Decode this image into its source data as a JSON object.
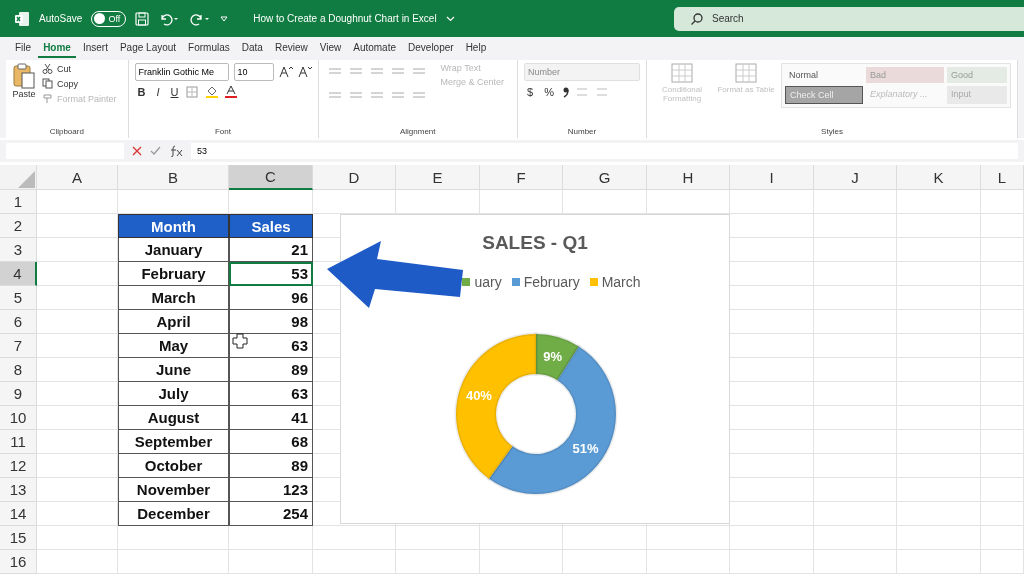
{
  "title_bar": {
    "autosave_label": "AutoSave",
    "autosave": {
      "label": "Off",
      "on": false
    },
    "document_title": "How to Create a Doughnut Chart in Excel",
    "search": {
      "placeholder": "Search"
    }
  },
  "menu_tabs": [
    {
      "label": "File",
      "selected": false
    },
    {
      "label": "Home",
      "selected": true
    },
    {
      "label": "Insert",
      "selected": false
    },
    {
      "label": "Page Layout",
      "selected": false
    },
    {
      "label": "Formulas",
      "selected": false
    },
    {
      "label": "Data",
      "selected": false
    },
    {
      "label": "Review",
      "selected": false
    },
    {
      "label": "View",
      "selected": false
    },
    {
      "label": "Automate",
      "selected": false
    },
    {
      "label": "Developer",
      "selected": false
    },
    {
      "label": "Help",
      "selected": false
    }
  ],
  "ribbon": {
    "clipboard": {
      "label": "Clipboard",
      "paste": "Paste",
      "cut": "Cut",
      "copy": "Copy",
      "format_painter": {
        "label": "Format Painter",
        "disabled": true
      }
    },
    "font": {
      "label": "Font",
      "font_name": "Franklin Gothic Me",
      "font_size": "10",
      "bold": "B",
      "italic": "I",
      "underline": "U"
    },
    "alignment": {
      "label": "Alignment",
      "wrap_text": {
        "label": "Wrap Text",
        "disabled": true
      },
      "merge_center": {
        "label": "Merge & Center",
        "disabled": true
      }
    },
    "number": {
      "label": "Number",
      "format": {
        "value": "Number",
        "disabled": true
      },
      "currency": "$",
      "percent": "%"
    },
    "styles": {
      "label": "Styles",
      "conditional_formatting": {
        "label": "Conditional Formatting",
        "disabled": true
      },
      "format_as_table": {
        "label": "Format as Table",
        "disabled": true
      },
      "cell_styles": [
        {
          "label": "Normal",
          "kind": "normal"
        },
        {
          "label": "Bad",
          "kind": "bad"
        },
        {
          "label": "Good",
          "kind": "good"
        },
        {
          "label": "Check Cell",
          "kind": "check"
        },
        {
          "label": "Explanatory ...",
          "kind": "explanatory"
        },
        {
          "label": "Input",
          "kind": "input"
        }
      ]
    }
  },
  "formula_bar": {
    "value": "53"
  },
  "sheet": {
    "columns": [
      {
        "label": "A",
        "selected": false
      },
      {
        "label": "B",
        "selected": false
      },
      {
        "label": "C",
        "selected": true
      },
      {
        "label": "D",
        "selected": false
      },
      {
        "label": "E",
        "selected": false
      },
      {
        "label": "F",
        "selected": false
      },
      {
        "label": "G",
        "selected": false
      },
      {
        "label": "H",
        "selected": false
      },
      {
        "label": "I",
        "selected": false
      },
      {
        "label": "J",
        "selected": false
      },
      {
        "label": "K",
        "selected": false
      },
      {
        "label": "L",
        "selected": false
      }
    ],
    "rows": [
      {
        "label": "1",
        "selected": false
      },
      {
        "label": "2",
        "selected": false
      },
      {
        "label": "3",
        "selected": false
      },
      {
        "label": "4",
        "selected": true
      },
      {
        "label": "5",
        "selected": false
      },
      {
        "label": "6",
        "selected": false
      },
      {
        "label": "7",
        "selected": false
      },
      {
        "label": "8",
        "selected": false
      },
      {
        "label": "9",
        "selected": false
      },
      {
        "label": "10",
        "selected": false
      },
      {
        "label": "11",
        "selected": false
      },
      {
        "label": "12",
        "selected": false
      },
      {
        "label": "13",
        "selected": false
      },
      {
        "label": "14",
        "selected": false
      },
      {
        "label": "15",
        "selected": false
      },
      {
        "label": "16",
        "selected": false
      }
    ],
    "table": {
      "header": [
        "Month",
        "Sales"
      ],
      "rows": [
        {
          "month": "January",
          "sales": "21",
          "selected": false
        },
        {
          "month": "February",
          "sales": "53",
          "selected": true
        },
        {
          "month": "March",
          "sales": "96",
          "selected": false
        },
        {
          "month": "April",
          "sales": "98",
          "selected": false
        },
        {
          "month": "May",
          "sales": "63",
          "selected": false
        },
        {
          "month": "June",
          "sales": "89",
          "selected": false
        },
        {
          "month": "July",
          "sales": "63",
          "selected": false
        },
        {
          "month": "August",
          "sales": "41",
          "selected": false
        },
        {
          "month": "September",
          "sales": "68",
          "selected": false
        },
        {
          "month": "October",
          "sales": "89",
          "selected": false
        },
        {
          "month": "November",
          "sales": "123",
          "selected": false
        },
        {
          "month": "December",
          "sales": "254",
          "selected": false
        }
      ]
    }
  },
  "chart": {
    "chart_data": {
      "type": "donut",
      "title": "SALES - Q1",
      "categories": [
        "uary",
        "February",
        "March"
      ],
      "values": [
        9,
        51,
        40
      ],
      "value_labels": [
        "9%",
        "51%",
        "40%"
      ],
      "legend": "top"
    },
    "segments": [
      {
        "color": "#70ad47"
      },
      {
        "color": "#5b9bd5"
      },
      {
        "color": "#ffc000"
      }
    ]
  }
}
